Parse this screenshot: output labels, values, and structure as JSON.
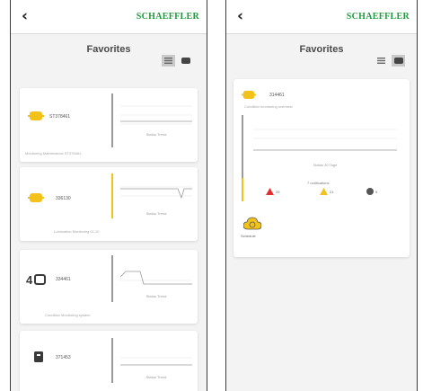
{
  "header": {
    "back_glyph": "‹",
    "brand": "SCHAEFFLER"
  },
  "page_title": "Favorites",
  "view_toggle": {
    "list_icon": "list-view-icon",
    "tile_icon": "tile-view-icon"
  },
  "left_screen": {
    "active_view": "list",
    "cards": [
      {
        "icon": "sensor-icon",
        "name": "ST378461",
        "chart_caption": "Status Trend",
        "footer": "Monitoring Maintenance ST378461",
        "status": "ok"
      },
      {
        "icon": "sensor-warning-icon",
        "name": "336130",
        "chart_caption": "Status Trend",
        "footer": "Lubrication Monitoring 01.10",
        "status": "warning"
      },
      {
        "icon": "sensor-4g-icon",
        "name": "334461",
        "chart_caption": "Status Trend",
        "footer": "Condition Monitoring system",
        "status": "ok"
      },
      {
        "icon": "gateway-icon",
        "name": "371453",
        "chart_caption": "Status Trend",
        "footer": "",
        "status": "ok"
      }
    ]
  },
  "right_screen": {
    "active_view": "tile",
    "card": {
      "icon": "sensor-icon",
      "name": "314461",
      "subtitle": "Condition monitoring overview",
      "chart_caption": "Status 30 Tage",
      "notifications_label": "7 notifications",
      "counts": [
        {
          "icon": "alarm-triangle-red-icon",
          "color": "#e0302e",
          "value": "25"
        },
        {
          "icon": "warning-triangle-yellow-icon",
          "color": "#f2c21a",
          "value": "21"
        },
        {
          "icon": "info-circle-gray-icon",
          "color": "#555555",
          "value": "5"
        }
      ],
      "action": {
        "icon": "cloud-sync-icon",
        "label": "Schedule"
      }
    }
  },
  "colors": {
    "brand": "#1f9a3e",
    "warning": "#f0c21a",
    "alarm": "#e0302e"
  }
}
